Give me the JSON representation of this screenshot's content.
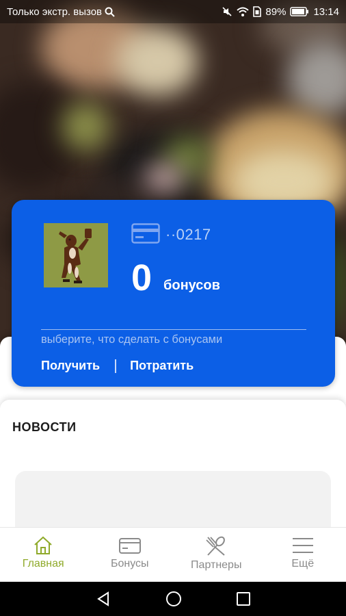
{
  "status_bar": {
    "carrier_text": "Только экстр. вызов",
    "battery": "89%",
    "time": "13:14",
    "icons": [
      "search-icon",
      "mute-icon",
      "wifi-icon",
      "sim-icon",
      "battery-icon"
    ]
  },
  "bonus_card": {
    "card_number": "··0217",
    "bonus_count": "0",
    "bonus_word": "бонусов",
    "hint": "выберите, что сделать с бонусами",
    "get_label": "Получить",
    "spend_label": "Потратить",
    "accent_color": "#0c5fe6"
  },
  "news": {
    "title": "НОВОСТИ"
  },
  "bottom_nav": {
    "items": [
      {
        "label": "Главная",
        "icon": "home-icon",
        "active": true
      },
      {
        "label": "Бонусы",
        "icon": "card-icon",
        "active": false
      },
      {
        "label": "Партнеры",
        "icon": "utensils-icon",
        "active": false
      },
      {
        "label": "Ещё",
        "icon": "menu-icon",
        "active": false
      }
    ],
    "active_color": "#8faa2a"
  },
  "system_nav": {
    "icons": [
      "back-icon",
      "home-circle-icon",
      "recents-icon"
    ]
  }
}
